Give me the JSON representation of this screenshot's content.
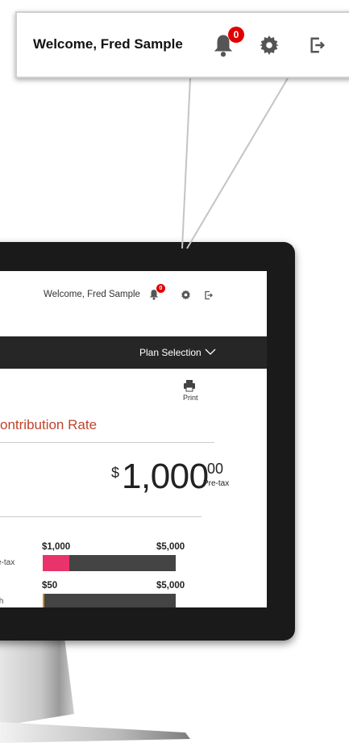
{
  "callout": {
    "welcome": "Welcome, Fred Sample",
    "notification_count": "0",
    "icons": {
      "bell": "bell-icon",
      "settings": "gear-icon",
      "logout": "logout-icon"
    }
  },
  "screen": {
    "header": {
      "welcome": "Welcome,  Fred Sample",
      "notification_count": "0"
    },
    "nav": {
      "plan_selection": "Plan Selection"
    },
    "print_label": "Print",
    "section_title": "ontribution Rate",
    "amount": {
      "currency": "$",
      "whole": "1,000",
      "cents": ".00",
      "label": "Pre-tax"
    },
    "ranges": [
      {
        "label": "e-tax",
        "min": "$1,000",
        "max": "$5,000",
        "fill_fraction": 0.2,
        "fill_color": "#e8336b"
      },
      {
        "label": "th",
        "min": "$50",
        "max": "$5,000",
        "fill_fraction": 0.01,
        "fill_color": "#d98b1c"
      }
    ]
  },
  "colors": {
    "accent_red": "#c0432e",
    "navbar": "#262626",
    "badge": "#e00000"
  }
}
